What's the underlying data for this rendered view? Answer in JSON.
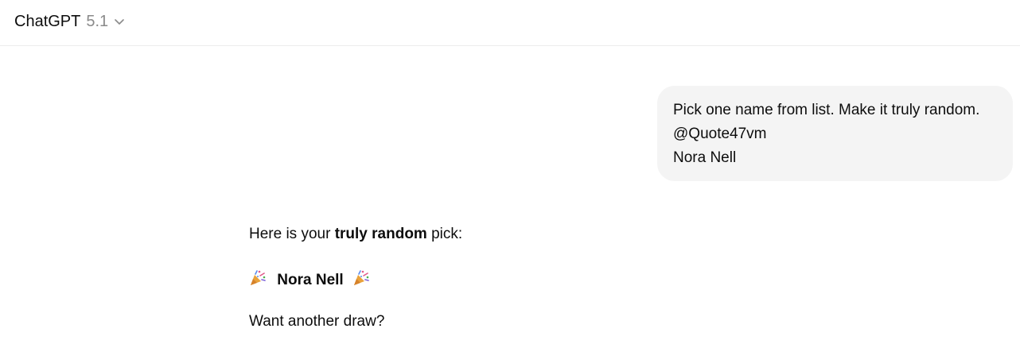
{
  "header": {
    "model_name": "ChatGPT",
    "model_version": "5.1"
  },
  "user_message": {
    "lines": [
      "Pick one name from list. Make it truly random.",
      "@Quote47vm",
      "Nora Nell"
    ]
  },
  "assistant_message": {
    "intro_prefix": "Here is your ",
    "intro_bold": "truly random",
    "intro_suffix": " pick:",
    "pick_name": "Nora Nell",
    "closing": "Want another draw?"
  },
  "icons": {
    "emoji": "party-popper-icon",
    "chevron": "chevron-down-icon"
  },
  "colors": {
    "bubble_bg": "#f4f4f4",
    "muted_text": "#8a8a8a"
  }
}
